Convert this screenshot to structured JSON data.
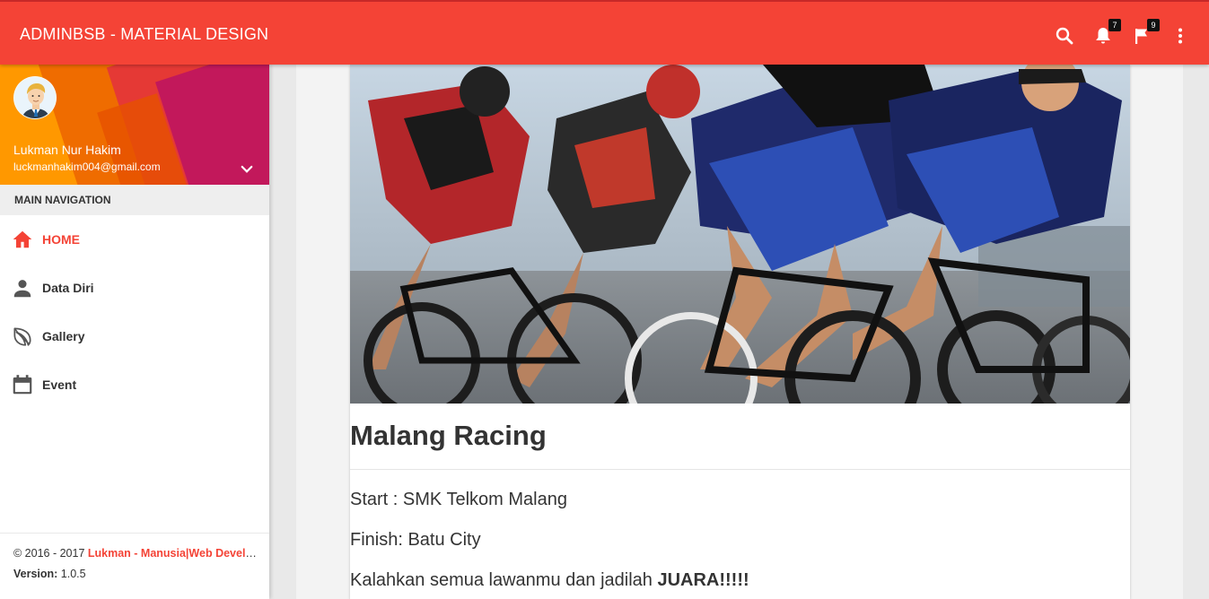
{
  "navbar": {
    "brand": "ADMINBSB - MATERIAL DESIGN",
    "notification_count": "7",
    "flag_count": "9",
    "bg_color": "#f44336"
  },
  "sidebar": {
    "user_name": "Lukman Nur Hakim",
    "user_email": "luckmanhakim004@gmail.com",
    "section_header": "MAIN NAVIGATION",
    "items": [
      {
        "label": "HOME",
        "icon": "home-icon",
        "active": true
      },
      {
        "label": "Data Diri",
        "icon": "person-icon",
        "active": false
      },
      {
        "label": "Gallery",
        "icon": "leaf-icon",
        "active": false
      },
      {
        "label": "Event",
        "icon": "calendar-icon",
        "active": false
      }
    ],
    "footer": {
      "copyright_prefix": "© 2016 - 2017 ",
      "copyright_link": "Lukman - Manusia|Web Developer",
      "version_label": "Version:",
      "version_value": " 1.0.5"
    }
  },
  "card": {
    "title": "Malang Racing",
    "start": "Start : SMK Telkom Malang",
    "finish": "Finish: Batu City",
    "slogan_prefix": "Kalahkan semua lawanmu dan jadilah ",
    "slogan_bold": "JUARA!!!!!"
  },
  "colors": {
    "accent": "#f44336",
    "text": "#333333"
  }
}
